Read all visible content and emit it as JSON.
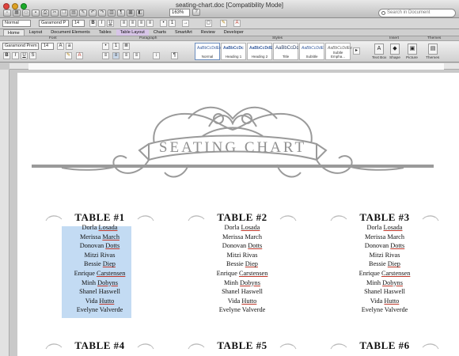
{
  "window": {
    "title": "seating-chart.doc [Compatibility Mode]",
    "search_placeholder": "Search in Document",
    "zoom": "163%"
  },
  "ribbon": {
    "style_select": "Normal",
    "font_select": "Garamond P",
    "size_select": "14",
    "font_name": "Garamond Prem",
    "font_size": "14",
    "tabs": [
      "Home",
      "Layout",
      "Document Elements",
      "Tables",
      "Table Layout",
      "Charts",
      "SmartArt",
      "Review",
      "Developer"
    ],
    "groups": [
      "Font",
      "Paragraph",
      "Styles",
      "Insert",
      "Themes"
    ],
    "styles": [
      {
        "sample": "AaBbCcDdEe",
        "name": "Normal"
      },
      {
        "sample": "AaBbCcDc",
        "name": "Heading 1"
      },
      {
        "sample": "AaBbCcDdE",
        "name": "Heading 2"
      },
      {
        "sample": "AaBbCcDc",
        "name": "Title"
      },
      {
        "sample": "AaBbCcDdE",
        "name": "Subtitle"
      },
      {
        "sample": "AaBbCcDdEe",
        "name": "Subtle Empha..."
      }
    ],
    "insert": [
      "Text Box",
      "Shape",
      "Picture"
    ],
    "themes": "Themes"
  },
  "document": {
    "banner": "SEATING CHART",
    "tables": [
      {
        "title": "TABLE #1",
        "guests": [
          [
            "Dorla ",
            "Losada"
          ],
          [
            "Merissa ",
            "March"
          ],
          [
            "Donovan ",
            "Dotts"
          ],
          [
            "Mitzi Rivas",
            ""
          ],
          [
            "Bessie ",
            "Diep"
          ],
          [
            "Enrique ",
            "Carstensen"
          ],
          [
            "Minh ",
            "Dobyns"
          ],
          [
            "Shanel Haswell",
            ""
          ],
          [
            "Vida ",
            "Hutto"
          ],
          [
            "Evelyne Valverde",
            ""
          ]
        ]
      },
      {
        "title": "TABLE #2",
        "guests": [
          [
            "Dorla ",
            "Losada"
          ],
          [
            "Merissa March",
            ""
          ],
          [
            "Donovan ",
            "Dotts"
          ],
          [
            "Mitzi Rivas",
            ""
          ],
          [
            "Bessie ",
            "Diep"
          ],
          [
            "Enrique ",
            "Carstensen"
          ],
          [
            "Minh ",
            "Dobyns"
          ],
          [
            "Shanel Haswell",
            ""
          ],
          [
            "Vida ",
            "Hutto"
          ],
          [
            "Evelyne Valverde",
            ""
          ]
        ]
      },
      {
        "title": "TABLE #3",
        "guests": [
          [
            "Dorla ",
            "Losada"
          ],
          [
            "Merissa March",
            ""
          ],
          [
            "Donovan ",
            "Dotts"
          ],
          [
            "Mitzi Rivas",
            ""
          ],
          [
            "Bessie ",
            "Diep"
          ],
          [
            "Enrique ",
            "Carstensen"
          ],
          [
            "Minh ",
            "Dobyns"
          ],
          [
            "Shanel Haswell",
            ""
          ],
          [
            "Vida ",
            "Hutto"
          ],
          [
            "Evelyne Valverde",
            ""
          ]
        ]
      },
      {
        "title": "TABLE #4",
        "guests": []
      },
      {
        "title": "TABLE #5",
        "guests": []
      },
      {
        "title": "TABLE #6",
        "guests": []
      }
    ]
  }
}
